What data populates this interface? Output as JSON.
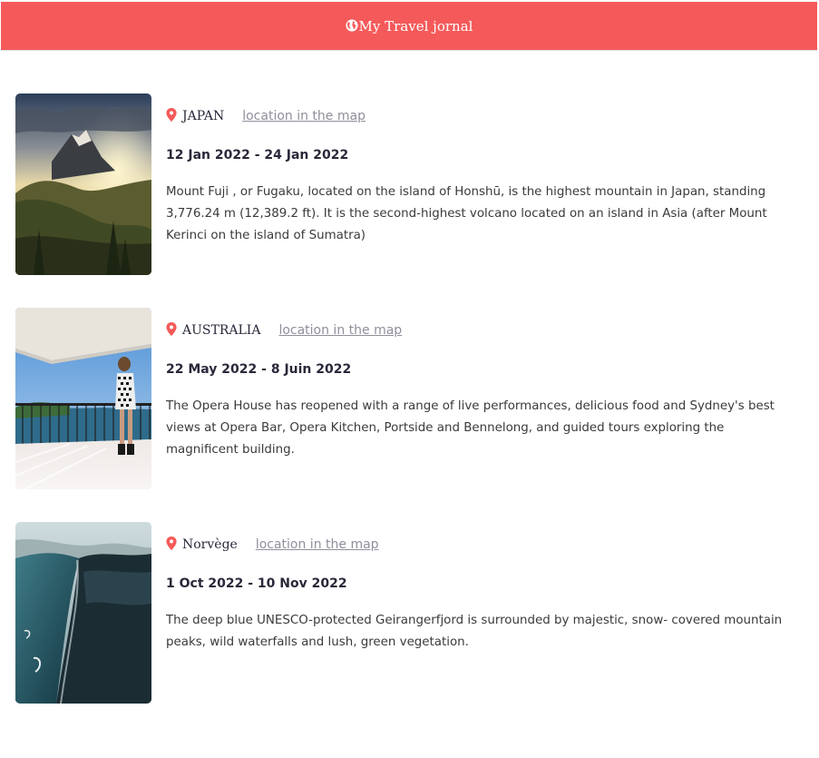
{
  "header": {
    "title": "My Travel jornal",
    "bg_color": "#f55a5a",
    "icon": "globe-icon"
  },
  "entries": [
    {
      "country": "JAPAN",
      "map_link": "location in the map",
      "dates": "12 Jan 2022 - 24 Jan 2022",
      "description": "Mount Fuji , or Fugaku, located on the island of Honshū, is the highest mountain in Japan, standing 3,776.24 m (12,389.2 ft). It is the second-highest volcano located on an island in Asia (after Mount Kerinci on the island of Sumatra)",
      "image": "mountain-sunset-photo"
    },
    {
      "country": "AUSTRALIA",
      "map_link": "location in the map",
      "dates": "22 May 2022 - 8 Juin 2022",
      "description": "The Opera House has reopened with a range of live performances, delicious food and Sydney's best views at Opera Bar, Opera Kitchen, Portside and Bennelong, and guided tours exploring the magnificent building.",
      "image": "balcony-harbour-photo"
    },
    {
      "country": "Norvège",
      "map_link": "location in the map",
      "dates": "1 Oct 2022 - 10 Nov 2022",
      "description": "The deep blue UNESCO-protected Geirangerfjord is surrounded by majestic, snow- covered mountain peaks, wild waterfalls and lush, green vegetation.",
      "image": "fjord-aerial-photo"
    }
  ],
  "colors": {
    "pin": "#f55a5a",
    "link": "#918e9b",
    "text": "#2b283a"
  }
}
